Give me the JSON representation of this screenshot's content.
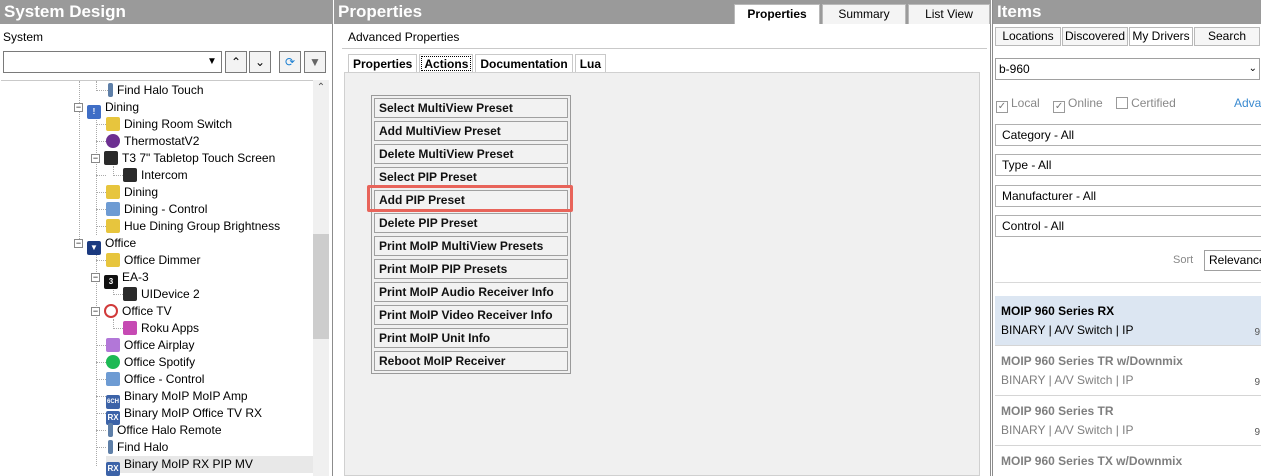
{
  "left_panel": {
    "title": "System Design",
    "sub_label": "System",
    "tree": [
      {
        "label": "Find Halo Touch",
        "icon": "halo-remote-icon"
      },
      {
        "label": "Dining",
        "icon": "room-icon"
      },
      {
        "label": "Dining Room Switch",
        "icon": "light-switch-icon"
      },
      {
        "label": "ThermostatV2",
        "icon": "thermostat-icon"
      },
      {
        "label": "T3 7\" Tabletop Touch Screen",
        "icon": "touch-screen-icon"
      },
      {
        "label": "Intercom",
        "icon": "intercom-icon"
      },
      {
        "label": "Dining",
        "icon": "light-icon"
      },
      {
        "label": "Dining - Control",
        "icon": "control-icon"
      },
      {
        "label": "Hue Dining Group Brightness",
        "icon": "light-icon"
      },
      {
        "label": "Office",
        "icon": "room-icon"
      },
      {
        "label": "Office Dimmer",
        "icon": "light-icon"
      },
      {
        "label": "EA-3",
        "icon": "controller-icon"
      },
      {
        "label": "UIDevice 2",
        "icon": "ui-device-icon"
      },
      {
        "label": "Office TV",
        "icon": "tv-icon"
      },
      {
        "label": "Roku Apps",
        "icon": "apps-icon"
      },
      {
        "label": "Office Airplay",
        "icon": "airplay-icon"
      },
      {
        "label": "Office Spotify",
        "icon": "spotify-icon"
      },
      {
        "label": "Office - Control",
        "icon": "control-icon"
      },
      {
        "label": "Binary MoIP MoIP Amp",
        "icon": "amp-icon"
      },
      {
        "label": "Binary MoIP Office TV RX",
        "icon": "rx-icon"
      },
      {
        "label": "Office Halo Remote",
        "icon": "halo-remote-icon"
      },
      {
        "label": "Find Halo",
        "icon": "halo-remote-icon"
      },
      {
        "label": "Binary MoIP RX PIP MV",
        "icon": "rx-icon"
      }
    ]
  },
  "middle_panel": {
    "title": "Properties",
    "top_tabs": [
      "Properties",
      "Summary",
      "List View"
    ],
    "section_label": "Advanced Properties",
    "inner_tabs": [
      "Properties",
      "Actions",
      "Documentation",
      "Lua"
    ],
    "actions": [
      "Select MultiView Preset",
      "Add MultiView Preset",
      "Delete MultiView Preset",
      "Select PIP Preset",
      "Add PIP Preset",
      "Delete PIP Preset",
      "Print MoIP MultiView Presets",
      "Print MoIP PIP Presets",
      "Print MoIP Audio Receiver Info",
      "Print MoIP Video Receiver Info",
      "Print MoIP Unit Info",
      "Reboot MoIP Receiver"
    ],
    "highlight_color": "#e8645a"
  },
  "right_panel": {
    "title": "Items",
    "tabs": [
      "Locations",
      "Discovered",
      "My Drivers",
      "Search"
    ],
    "search_value": "b-960",
    "checks": [
      {
        "label": "Local",
        "checked": true
      },
      {
        "label": "Online",
        "checked": true
      },
      {
        "label": "Certified",
        "checked": false
      }
    ],
    "advanced_link": "Adva",
    "filters": [
      "Category - All",
      "Type - All",
      "Manufacturer - All",
      "Control - All"
    ],
    "sort_label": "Sort",
    "sort_value": "Relevance",
    "items": [
      {
        "name": "MOIP 960 Series RX",
        "meta": "BINARY  |  A/V Switch  |  IP",
        "extra": "9"
      },
      {
        "name": "MOIP 960 Series TR w/Downmix",
        "meta": "BINARY  |  A/V Switch  |  IP",
        "extra": "9"
      },
      {
        "name": "MOIP 960 Series TR",
        "meta": "BINARY  |  A/V Switch  |  IP",
        "extra": "9"
      },
      {
        "name": "MOIP 960 Series TX w/Downmix",
        "meta": "",
        "extra": ""
      }
    ]
  }
}
